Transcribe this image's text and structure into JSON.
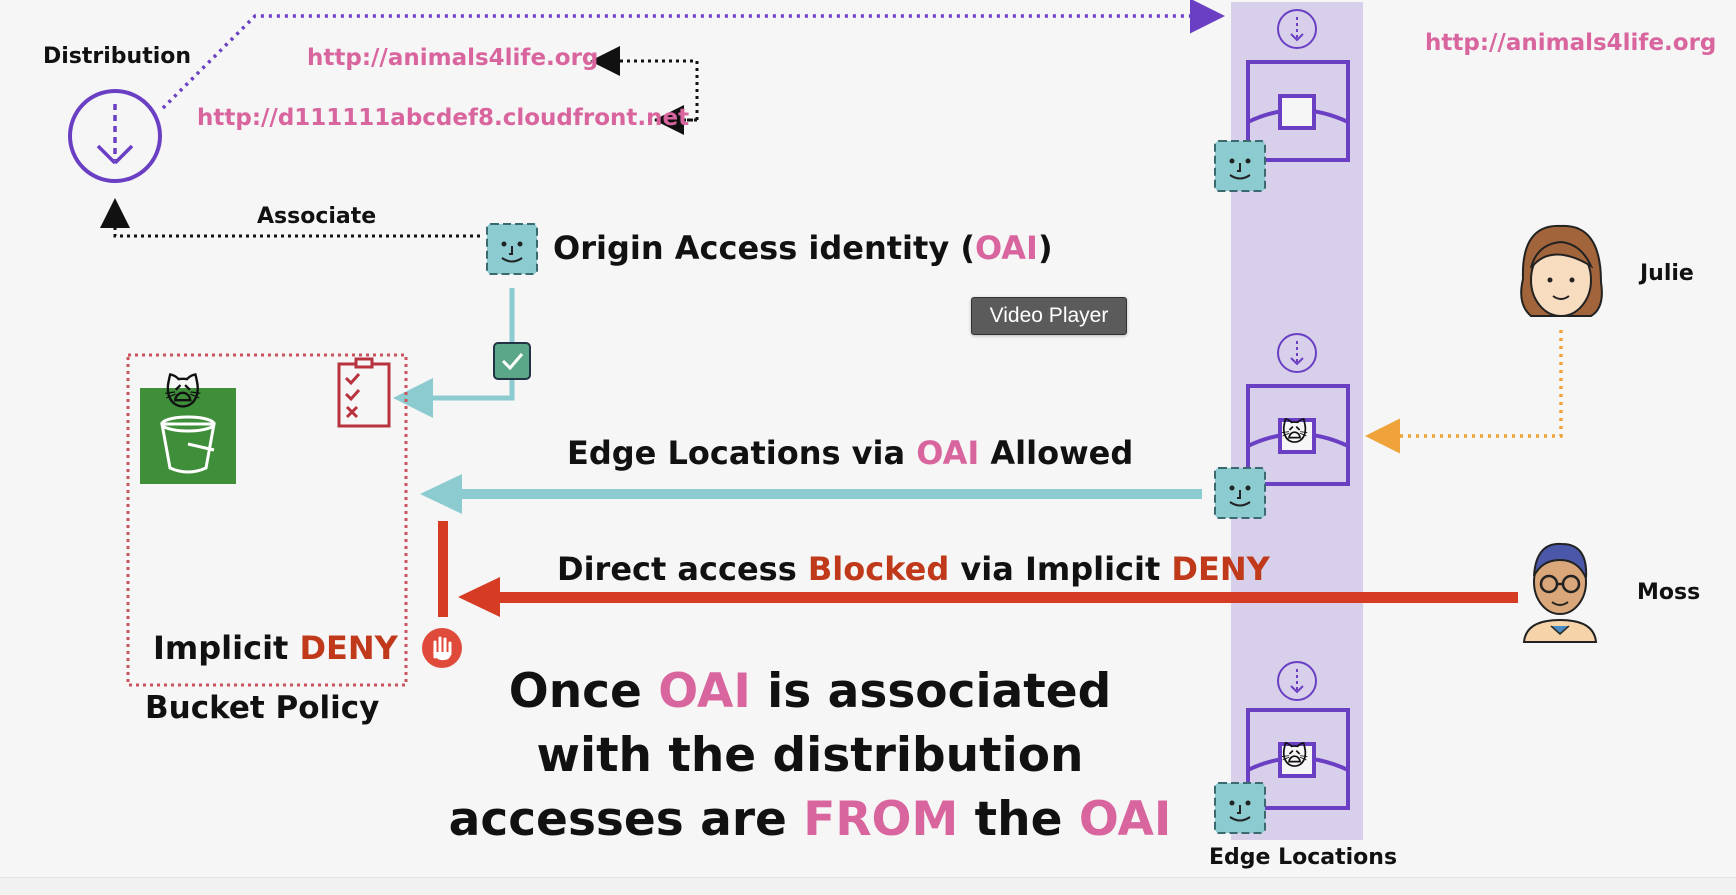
{
  "labels": {
    "distribution": "Distribution",
    "url_top": "http://animals4life.org",
    "url_cloudfront": "http://d111111abcdef8.cloudfront.net",
    "url_right": "http://animals4life.org",
    "associate": "Associate",
    "oai_prefix": "Origin Access identity (",
    "oai_abbr": "OAI",
    "oai_suffix": ")",
    "tooltip": "Video Player",
    "edge_allowed_1": "Edge Locations via ",
    "edge_allowed_oai": "OAI",
    "edge_allowed_2": " Allowed",
    "direct_1": "Direct access ",
    "direct_blocked": "Blocked",
    "direct_2": " via Implicit ",
    "direct_deny": "DENY",
    "implicit": "Implicit ",
    "implicit_deny": "DENY",
    "bucket_policy": "Bucket Policy",
    "julie": "Julie",
    "moss": "Moss",
    "edge_locations": "Edge Locations",
    "summary_l1_a": "Once ",
    "summary_l1_oai": "OAI",
    "summary_l1_b": " is associated",
    "summary_l2": "with the distribution",
    "summary_l3_a": "accesses are ",
    "summary_l3_from": "FROM",
    "summary_l3_b": " the ",
    "summary_l3_oai": "OAI"
  },
  "emoji": {
    "cat": "🙀"
  },
  "colors": {
    "purple": "#6a3fc4",
    "teal": "#8ccbd0",
    "red": "#d63b24",
    "pink": "#d9659e",
    "orange": "#f0a33a",
    "edge_band": "#d8d0ea",
    "bucket_green": "#3e8e3a"
  },
  "icons": [
    "distribution-icon",
    "oai-face-icon",
    "checkmark-icon",
    "policy-checklist-icon",
    "s3-bucket-icon",
    "stop-hand-icon",
    "edge-location-icon",
    "julie-avatar",
    "moss-avatar"
  ]
}
